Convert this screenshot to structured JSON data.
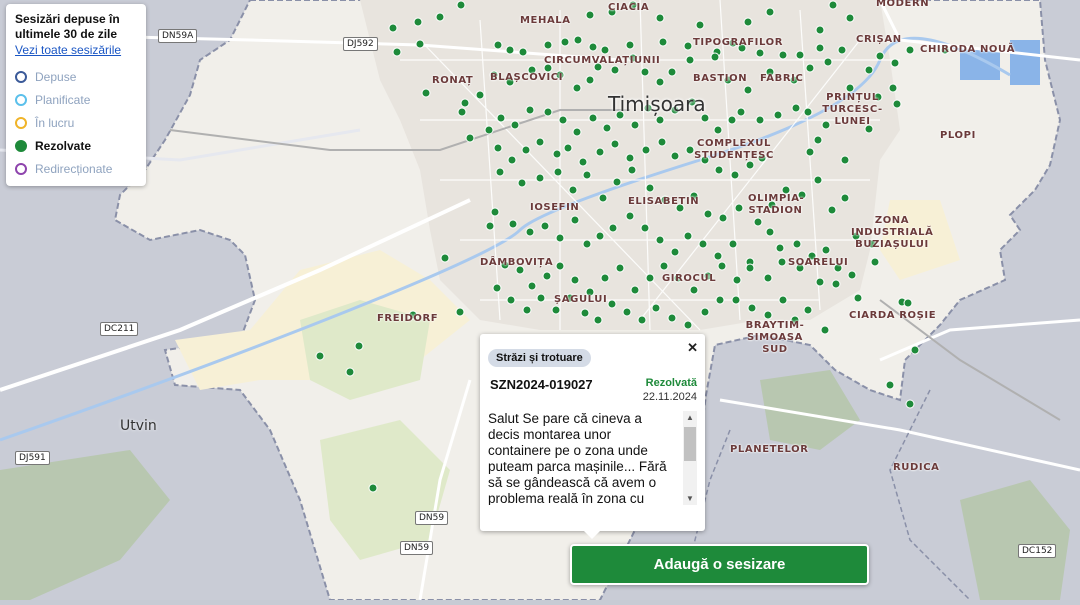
{
  "legend": {
    "title": "Sesizări depuse în ultimele 30 de zile",
    "link": "Vezi toate sesizările",
    "items": [
      {
        "label": "Depuse",
        "color": "#3b5a99",
        "active": false
      },
      {
        "label": "Planificate",
        "color": "#5bc0eb",
        "active": false
      },
      {
        "label": "În lucru",
        "color": "#f0b429",
        "active": false
      },
      {
        "label": "Rezolvate",
        "color": "#1e8a3a",
        "active": true
      },
      {
        "label": "Redirecționate",
        "color": "#8e44ad",
        "active": false
      }
    ]
  },
  "map": {
    "city": "Timișoara",
    "town": "Utvin",
    "districts": [
      "MEHALA",
      "RONAȚ",
      "BLAȘCOVICI",
      "CIRCUMVALAȚIUNII",
      "TIPOGRAFILOR",
      "BASTION",
      "FABRIC",
      "PRINȚUL TURCESC-LUNEI",
      "CRIȘAN",
      "PLOPI",
      "COMPLEXUL STUDENȚESC",
      "IOSEFIN",
      "ELISABETIN",
      "OLIMPIA-STADION",
      "ZONA INDUSTRIALĂ BUZIAȘULUI",
      "DÂMBOVIȚA",
      "GIROCUL",
      "SOARELUI",
      "ȘAGULUI",
      "FREIDORF",
      "BRAYTIM-SIMOASA SUD",
      "CIARDA ROȘIE",
      "PLANETELOR",
      "RUDICA",
      "MODERN",
      "CHIRODA NOUĂ",
      "CIACIA"
    ],
    "roads": [
      "DN59A",
      "DJ592",
      "DC211",
      "DJ591",
      "DN59",
      "DN59",
      "DC152"
    ]
  },
  "popup": {
    "category": "Străzi și trotuare",
    "id": "SZN2024-019027",
    "status": "Rezolvată",
    "date": "22.11.2024",
    "description": "Salut Se pare că cineva a decis montarea unor containere pe o zona unde puteam parca mașinile... Fără să se gândească că avem o problema reală în zona cu locurile de parcare. O cu un soluție trebuie găsită."
  },
  "add_button": "Adaugă o sesizare",
  "marker_color": "#1e8a3a"
}
